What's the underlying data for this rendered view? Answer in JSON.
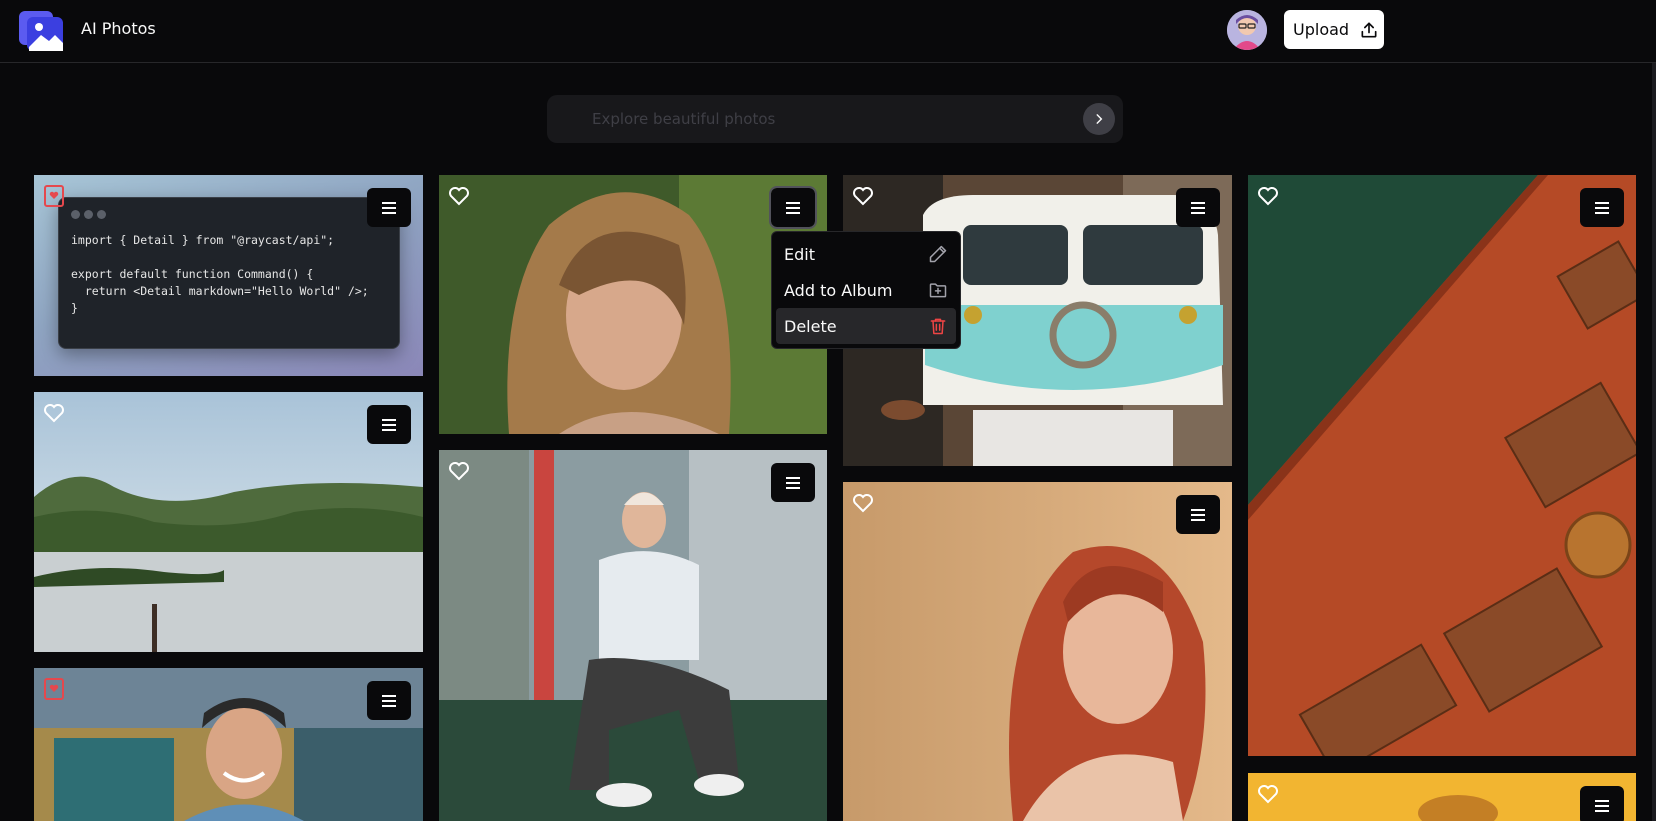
{
  "app": {
    "title": "AI Photos"
  },
  "header": {
    "upload_label": "Upload"
  },
  "search": {
    "placeholder": "Explore beautiful photos"
  },
  "context_menu": {
    "items": [
      {
        "label": "Edit",
        "icon": "pencil-icon"
      },
      {
        "label": "Add to Album",
        "icon": "folder-plus-icon"
      },
      {
        "label": "Delete",
        "icon": "trash-icon",
        "color": "#ef4444"
      }
    ]
  },
  "code_card": {
    "lines": [
      "import { Detail } from \"@raycast/api\";",
      "",
      "export default function Command() {",
      "  return <Detail markdown=\"Hello World\" />;",
      "}"
    ]
  },
  "photos": [
    {
      "id": "code",
      "favorited": true
    },
    {
      "id": "woman-blonde",
      "favorited": false
    },
    {
      "id": "vw-van",
      "favorited": false
    },
    {
      "id": "terracotta-stairs",
      "favorited": false
    },
    {
      "id": "lake-landscape",
      "favorited": false
    },
    {
      "id": "woman-sitting",
      "favorited": false
    },
    {
      "id": "woman-redhead",
      "favorited": false
    },
    {
      "id": "smiling-man",
      "favorited": true
    },
    {
      "id": "yellow-tree",
      "favorited": false
    }
  ],
  "colors": {
    "accent": "#ffffff",
    "background": "#09090b",
    "danger": "#ef4444",
    "favorite": "#e5484d"
  }
}
